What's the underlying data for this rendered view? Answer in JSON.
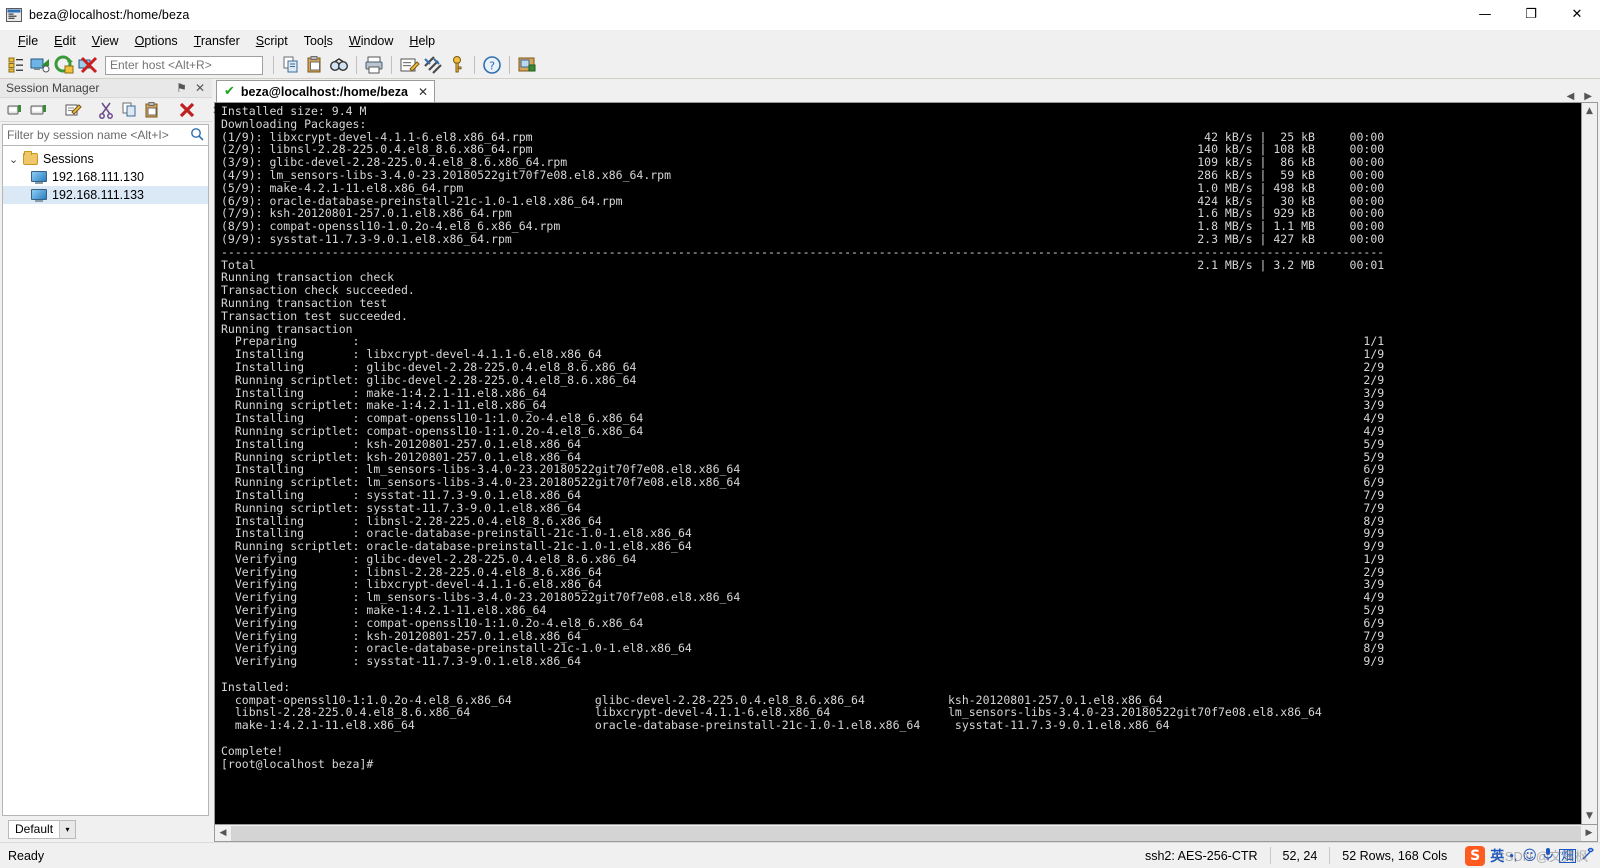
{
  "window": {
    "title": "beza@localhost:/home/beza",
    "app_icon": "securecrt-icon",
    "minimize": "—",
    "maximize": "❐",
    "close": "✕"
  },
  "menubar": {
    "items": [
      {
        "label": "File",
        "accel": "F"
      },
      {
        "label": "Edit",
        "accel": "E"
      },
      {
        "label": "View",
        "accel": "V"
      },
      {
        "label": "Options",
        "accel": "O"
      },
      {
        "label": "Transfer",
        "accel": "T"
      },
      {
        "label": "Script",
        "accel": "S"
      },
      {
        "label": "Tools",
        "accel": "l"
      },
      {
        "label": "Window",
        "accel": "W"
      },
      {
        "label": "Help",
        "accel": "H"
      }
    ]
  },
  "toolbar": {
    "icons_left": [
      "session-manager-icon",
      "connect-icon",
      "reconnect-icon",
      "disconnect-icon"
    ],
    "host_placeholder": "Enter host <Alt+R>",
    "icons_right": [
      "copy-icon",
      "paste-icon",
      "find-icon",
      "print-icon",
      "log-session-icon",
      "settings-icon",
      "key-icon",
      "help-icon",
      "new-window-icon"
    ]
  },
  "session_manager": {
    "title": "Session Manager",
    "pin": "⚑",
    "close": "✕",
    "toolbar_icons": [
      "new-session-icon",
      "new-folder-icon",
      "properties-icon",
      "cut-icon",
      "copy-icon",
      "paste-icon",
      "delete-icon",
      "overflow-icon"
    ],
    "filter_placeholder": "Filter by session name <Alt+I>",
    "search_icon": "search-icon",
    "tree": {
      "root": {
        "label": "Sessions",
        "expanded": true,
        "chevron": "⌄"
      },
      "children": [
        {
          "label": "192.168.111.130",
          "selected": false
        },
        {
          "label": "192.168.111.133",
          "selected": true
        }
      ]
    },
    "footer": {
      "default_label": "Default",
      "arrow": "▾"
    }
  },
  "tabbar": {
    "tabs": [
      {
        "label": "beza@localhost:/home/beza",
        "status_icon": "check-icon",
        "close": "✕",
        "active": true
      }
    ],
    "nav_left": "◀",
    "nav_right": "▶"
  },
  "terminal": {
    "cols": 168,
    "rows": 52,
    "lines": [
      {
        "text": "Installed size: 9.4 M"
      },
      {
        "text": "Downloading Packages:"
      },
      {
        "text": "(1/9): libxcrypt-devel-4.1.1-6.el8.x86_64.rpm",
        "right": "42 kB/s |  25 kB     00:00"
      },
      {
        "text": "(2/9): libnsl-2.28-225.0.4.el8_8.6.x86_64.rpm",
        "right": "140 kB/s | 108 kB     00:00"
      },
      {
        "text": "(3/9): glibc-devel-2.28-225.0.4.el8_8.6.x86_64.rpm",
        "right": "109 kB/s |  86 kB     00:00"
      },
      {
        "text": "(4/9): lm_sensors-libs-3.4.0-23.20180522git70f7e08.el8.x86_64.rpm",
        "right": "286 kB/s |  59 kB     00:00"
      },
      {
        "text": "(5/9): make-4.2.1-11.el8.x86_64.rpm",
        "right": "1.0 MB/s | 498 kB     00:00"
      },
      {
        "text": "(6/9): oracle-database-preinstall-21c-1.0-1.el8.x86_64.rpm",
        "right": "424 kB/s |  30 kB     00:00"
      },
      {
        "text": "(7/9): ksh-20120801-257.0.1.el8.x86_64.rpm",
        "right": "1.6 MB/s | 929 kB     00:00"
      },
      {
        "text": "(8/9): compat-openssl10-1.0.2o-4.el8_6.x86_64.rpm",
        "right": "1.8 MB/s | 1.1 MB     00:00"
      },
      {
        "text": "(9/9): sysstat-11.7.3-9.0.1.el8.x86_64.rpm",
        "right": "2.3 MB/s | 427 kB     00:00"
      },
      {
        "separator": true
      },
      {
        "text": "Total",
        "right": "2.1 MB/s | 3.2 MB     00:01"
      },
      {
        "text": "Running transaction check"
      },
      {
        "text": "Transaction check succeeded."
      },
      {
        "text": "Running transaction test"
      },
      {
        "text": "Transaction test succeeded."
      },
      {
        "text": "Running transaction"
      },
      {
        "text": "  Preparing        :",
        "right": "1/1"
      },
      {
        "text": "  Installing       : libxcrypt-devel-4.1.1-6.el8.x86_64",
        "right": "1/9"
      },
      {
        "text": "  Installing       : glibc-devel-2.28-225.0.4.el8_8.6.x86_64",
        "right": "2/9"
      },
      {
        "text": "  Running scriptlet: glibc-devel-2.28-225.0.4.el8_8.6.x86_64",
        "right": "2/9"
      },
      {
        "text": "  Installing       : make-1:4.2.1-11.el8.x86_64",
        "right": "3/9"
      },
      {
        "text": "  Running scriptlet: make-1:4.2.1-11.el8.x86_64",
        "right": "3/9"
      },
      {
        "text": "  Installing       : compat-openssl10-1:1.0.2o-4.el8_6.x86_64",
        "right": "4/9"
      },
      {
        "text": "  Running scriptlet: compat-openssl10-1:1.0.2o-4.el8_6.x86_64",
        "right": "4/9"
      },
      {
        "text": "  Installing       : ksh-20120801-257.0.1.el8.x86_64",
        "right": "5/9"
      },
      {
        "text": "  Running scriptlet: ksh-20120801-257.0.1.el8.x86_64",
        "right": "5/9"
      },
      {
        "text": "  Installing       : lm_sensors-libs-3.4.0-23.20180522git70f7e08.el8.x86_64",
        "right": "6/9"
      },
      {
        "text": "  Running scriptlet: lm_sensors-libs-3.4.0-23.20180522git70f7e08.el8.x86_64",
        "right": "6/9"
      },
      {
        "text": "  Installing       : sysstat-11.7.3-9.0.1.el8.x86_64",
        "right": "7/9"
      },
      {
        "text": "  Running scriptlet: sysstat-11.7.3-9.0.1.el8.x86_64",
        "right": "7/9"
      },
      {
        "text": "  Installing       : libnsl-2.28-225.0.4.el8_8.6.x86_64",
        "right": "8/9"
      },
      {
        "text": "  Installing       : oracle-database-preinstall-21c-1.0-1.el8.x86_64",
        "right": "9/9"
      },
      {
        "text": "  Running scriptlet: oracle-database-preinstall-21c-1.0-1.el8.x86_64",
        "right": "9/9"
      },
      {
        "text": "  Verifying        : glibc-devel-2.28-225.0.4.el8_8.6.x86_64",
        "right": "1/9"
      },
      {
        "text": "  Verifying        : libnsl-2.28-225.0.4.el8_8.6.x86_64",
        "right": "2/9"
      },
      {
        "text": "  Verifying        : libxcrypt-devel-4.1.1-6.el8.x86_64",
        "right": "3/9"
      },
      {
        "text": "  Verifying        : lm_sensors-libs-3.4.0-23.20180522git70f7e08.el8.x86_64",
        "right": "4/9"
      },
      {
        "text": "  Verifying        : make-1:4.2.1-11.el8.x86_64",
        "right": "5/9"
      },
      {
        "text": "  Verifying        : compat-openssl10-1:1.0.2o-4.el8_6.x86_64",
        "right": "6/9"
      },
      {
        "text": "  Verifying        : ksh-20120801-257.0.1.el8.x86_64",
        "right": "7/9"
      },
      {
        "text": "  Verifying        : oracle-database-preinstall-21c-1.0-1.el8.x86_64",
        "right": "8/9"
      },
      {
        "text": "  Verifying        : sysstat-11.7.3-9.0.1.el8.x86_64",
        "right": "9/9"
      },
      {
        "text": ""
      },
      {
        "text": "Installed:"
      },
      {
        "text": "  compat-openssl10-1:1.0.2o-4.el8_6.x86_64            glibc-devel-2.28-225.0.4.el8_8.6.x86_64            ksh-20120801-257.0.1.el8.x86_64"
      },
      {
        "text": "  libnsl-2.28-225.0.4.el8_8.6.x86_64                  libxcrypt-devel-4.1.1-6.el8.x86_64                 lm_sensors-libs-3.4.0-23.20180522git70f7e08.el8.x86_64"
      },
      {
        "text": "  make-1:4.2.1-11.el8.x86_64                          oracle-database-preinstall-21c-1.0-1.el8.x86_64     sysstat-11.7.3-9.0.1.el8.x86_64"
      },
      {
        "text": ""
      },
      {
        "text": "Complete!"
      },
      {
        "text": "[root@localhost beza]# "
      }
    ]
  },
  "statusbar": {
    "ready": "Ready",
    "protocol": "ssh2: AES-256-CTR",
    "cursor": "52, 24",
    "size": "52 Rows, 168 Cols",
    "ime": {
      "logo": "S",
      "mode": "英",
      "dot": "•,",
      "emoji": "☺",
      "mic": "mic-icon",
      "keyboard": "畑",
      "tools": "tools-icon"
    },
    "watermark": "CSDN @文其枫"
  }
}
